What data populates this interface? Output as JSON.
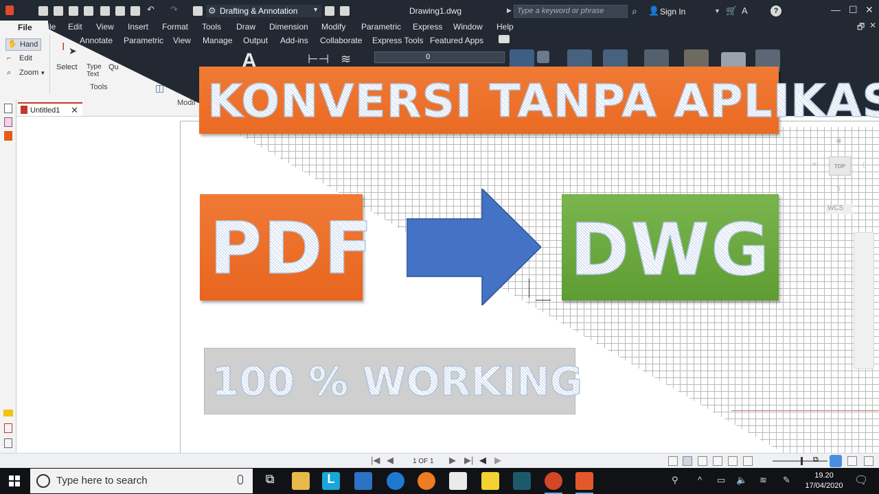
{
  "window": {
    "workspace": "Drafting & Annotation",
    "doc_title": "Drawing1.dwg",
    "search_placeholder": "Type a keyword or phrase",
    "sign_in": "Sign In"
  },
  "menu": {
    "file": "File",
    "items": [
      "File",
      "Edit",
      "View",
      "Insert",
      "Format",
      "Tools",
      "Draw",
      "Dimension",
      "Modify",
      "Parametric",
      "Express",
      "Window",
      "Help"
    ]
  },
  "ribbon_tabs": [
    "Annotate",
    "Parametric",
    "View",
    "Manage",
    "Output",
    "Add-ins",
    "Collaborate",
    "Express Tools",
    "Featured Apps"
  ],
  "layer_combo_value": "0",
  "left_tools": {
    "hand": "Hand",
    "edit": "Edit",
    "zoom": "Zoom",
    "select": "Select",
    "type_text_1": "Type",
    "type_text_2": "Text",
    "quick": "Qu",
    "tools_label": "Tools",
    "modify_fragment": "Modif"
  },
  "document_tab": "Untitled1",
  "banner": {
    "title": "KONVERSI TANPA APLIKASI",
    "from": "PDF",
    "to": "DWG",
    "status": "100 % WORKING"
  },
  "viewcube": {
    "face": "TOP",
    "wcs": "WCS"
  },
  "status_bar": {
    "page": "1 OF 1"
  },
  "taskbar": {
    "search_placeholder": "Type here to search",
    "time": "19.20",
    "date": "17/04/2020"
  },
  "colors": {
    "orange": "#ee7430",
    "green": "#6eab42",
    "arrow_blue": "#4472c4",
    "chrome_dark": "#222933"
  }
}
